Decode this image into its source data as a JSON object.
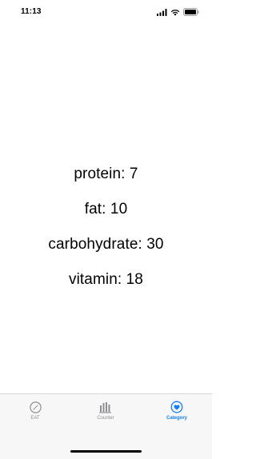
{
  "status_bar": {
    "time": "11:13",
    "icons": [
      "signal-icon",
      "wifi-icon",
      "battery-icon"
    ]
  },
  "nutrients": [
    {
      "label": "protein: 7"
    },
    {
      "label": "fat: 10"
    },
    {
      "label": "carbohydrate: 30"
    },
    {
      "label": "vitamin: 18"
    }
  ],
  "tab_bar": {
    "tabs": [
      {
        "label": "EAT",
        "icon": "compass-icon",
        "selected": false
      },
      {
        "label": "Counter",
        "icon": "bar-chart-icon",
        "selected": false
      },
      {
        "label": "Category",
        "icon": "heart-circle-icon",
        "selected": true
      }
    ]
  },
  "colors": {
    "accent": "#147efb",
    "inactive": "#8e8e93",
    "tab_bar_bg": "#f7f7f7"
  }
}
